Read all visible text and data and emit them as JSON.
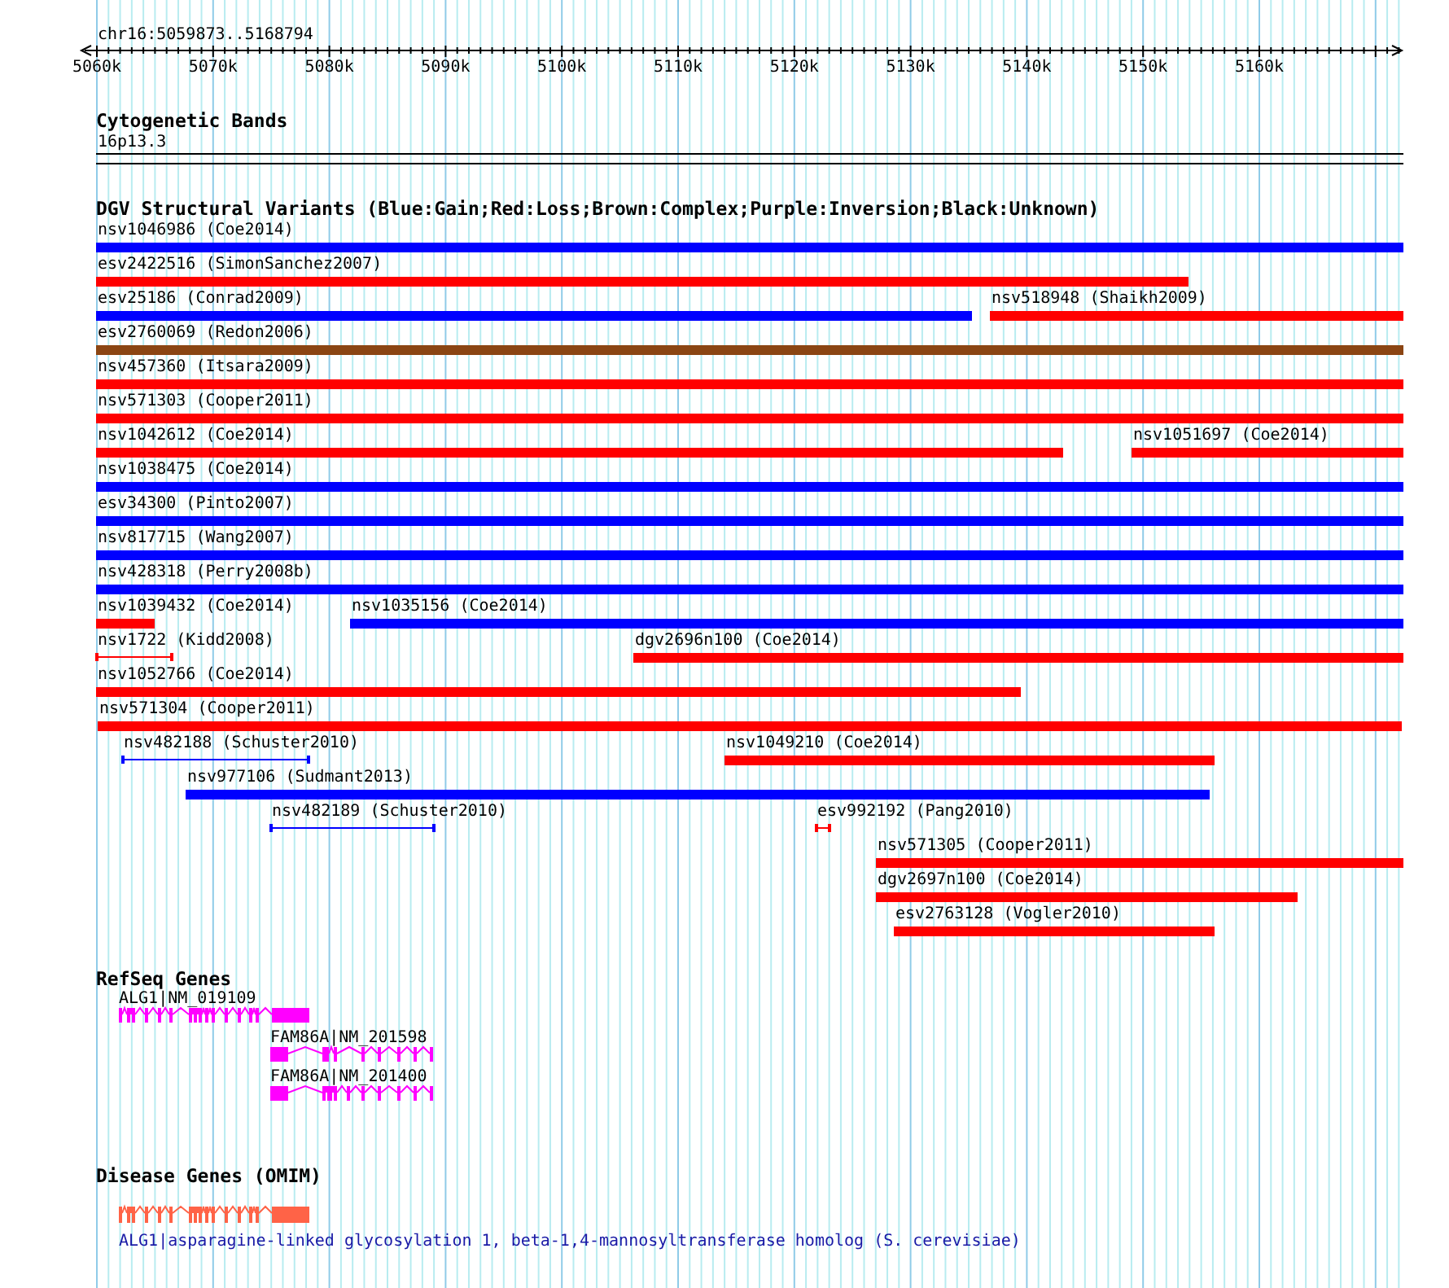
{
  "ruler": {
    "location": "chr16:5059873..5168794",
    "ticks": [
      "5060k",
      "5070k",
      "5080k",
      "5090k",
      "5100k",
      "5110k",
      "5120k",
      "5130k",
      "5140k",
      "5150k",
      "5160k"
    ]
  },
  "cytogenetic_bands": {
    "title": "Cytogenetic Bands",
    "band": "16p13.3"
  },
  "dgv": {
    "title": "DGV Structural Variants (Blue:Gain;Red:Loss;Brown:Complex;Purple:Inversion;Black:Unknown)",
    "rows": [
      {
        "features": [
          {
            "label": "nsv1046986 (Coe2014)",
            "color": "#0000ff",
            "kind": "bar"
          }
        ]
      },
      {
        "features": [
          {
            "label": "esv2422516 (SimonSanchez2007)",
            "color": "#ff0000",
            "kind": "bar"
          }
        ]
      },
      {
        "features": [
          {
            "label": "esv25186 (Conrad2009)",
            "color": "#0000ff",
            "kind": "bar"
          },
          {
            "label": "nsv518948 (Shaikh2009)",
            "color": "#ff0000",
            "kind": "bar"
          }
        ]
      },
      {
        "features": [
          {
            "label": "esv2760069 (Redon2006)",
            "color": "#8b4513",
            "kind": "bar"
          }
        ]
      },
      {
        "features": [
          {
            "label": "nsv457360 (Itsara2009)",
            "color": "#ff0000",
            "kind": "bar"
          }
        ]
      },
      {
        "features": [
          {
            "label": "nsv571303 (Cooper2011)",
            "color": "#ff0000",
            "kind": "bar"
          }
        ]
      },
      {
        "features": [
          {
            "label": "nsv1042612 (Coe2014)",
            "color": "#ff0000",
            "kind": "bar"
          },
          {
            "label": "nsv1051697 (Coe2014)",
            "color": "#ff0000",
            "kind": "bar"
          }
        ]
      },
      {
        "features": [
          {
            "label": "nsv1038475 (Coe2014)",
            "color": "#0000ff",
            "kind": "bar"
          }
        ]
      },
      {
        "features": [
          {
            "label": "esv34300 (Pinto2007)",
            "color": "#0000ff",
            "kind": "bar"
          }
        ]
      },
      {
        "features": [
          {
            "label": "nsv817715 (Wang2007)",
            "color": "#0000ff",
            "kind": "bar"
          }
        ]
      },
      {
        "features": [
          {
            "label": "nsv428318 (Perry2008b)",
            "color": "#0000ff",
            "kind": "bar"
          }
        ]
      },
      {
        "features": [
          {
            "label": "nsv1039432 (Coe2014)",
            "color": "#ff0000",
            "kind": "bar"
          },
          {
            "label": "nsv1035156 (Coe2014)",
            "color": "#0000ff",
            "kind": "bar"
          }
        ]
      },
      {
        "features": [
          {
            "label": "nsv1722 (Kidd2008)",
            "color": "#ff0000",
            "kind": "span"
          },
          {
            "label": "dgv2696n100 (Coe2014)",
            "color": "#ff0000",
            "kind": "bar"
          }
        ]
      },
      {
        "features": [
          {
            "label": "nsv1052766 (Coe2014)",
            "color": "#ff0000",
            "kind": "bar"
          }
        ]
      },
      {
        "features": [
          {
            "label": "nsv571304 (Cooper2011)",
            "color": "#ff0000",
            "kind": "bar"
          }
        ]
      },
      {
        "features": [
          {
            "label": "nsv482188 (Schuster2010)",
            "color": "#0000ff",
            "kind": "span"
          },
          {
            "label": "nsv1049210 (Coe2014)",
            "color": "#ff0000",
            "kind": "bar"
          }
        ]
      },
      {
        "features": [
          {
            "label": "nsv977106 (Sudmant2013)",
            "color": "#0000ff",
            "kind": "bar"
          }
        ]
      },
      {
        "features": [
          {
            "label": "nsv482189 (Schuster2010)",
            "color": "#0000ff",
            "kind": "span"
          },
          {
            "label": "esv992192 (Pang2010)",
            "color": "#ff0000",
            "kind": "span"
          }
        ]
      },
      {
        "features": [
          {
            "label": "nsv571305 (Cooper2011)",
            "color": "#ff0000",
            "kind": "bar"
          }
        ]
      },
      {
        "features": [
          {
            "label": "dgv2697n100 (Coe2014)",
            "color": "#ff0000",
            "kind": "bar"
          }
        ]
      },
      {
        "features": [
          {
            "label": "esv2763128 (Vogler2010)",
            "color": "#ff0000",
            "kind": "bar"
          }
        ]
      }
    ]
  },
  "refseq": {
    "title": "RefSeq Genes",
    "genes": [
      {
        "label": "ALG1|NM_019109"
      },
      {
        "label": "FAM86A|NM_201598"
      },
      {
        "label": "FAM86A|NM_201400"
      }
    ]
  },
  "omim": {
    "title": "Disease Genes (OMIM)",
    "genes": [
      {
        "description": "ALG1|asparagine-linked glycosylation 1, beta-1,4-mannosyltransferase homolog (S. cerevisiae)"
      }
    ]
  }
}
